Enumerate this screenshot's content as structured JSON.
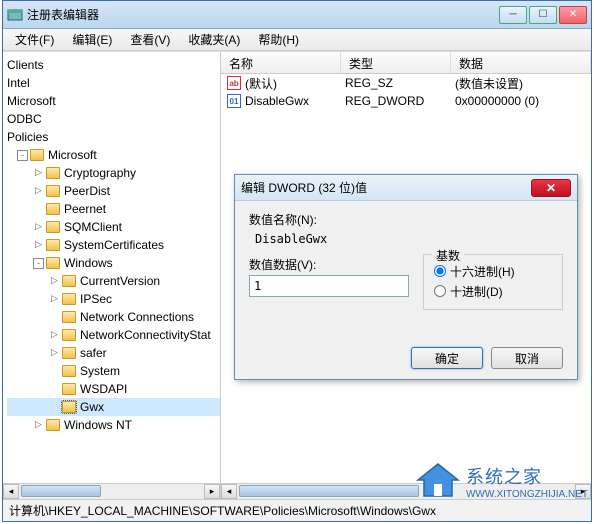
{
  "window": {
    "title": "注册表编辑器",
    "menus": [
      "文件(F)",
      "编辑(E)",
      "查看(V)",
      "收藏夹(A)",
      "帮助(H)"
    ]
  },
  "tree": {
    "roots": [
      "Clients",
      "Intel",
      "Microsoft",
      "ODBC",
      "Policies"
    ],
    "policies_microsoft": "Microsoft",
    "ms_children": [
      "Cryptography",
      "PeerDist",
      "Peernet",
      "SQMClient",
      "SystemCertificates"
    ],
    "windows_label": "Windows",
    "win_children": [
      "CurrentVersion",
      "IPSec",
      "Network Connections",
      "NetworkConnectivityStat",
      "safer",
      "System",
      "WSDAPI",
      "Gwx"
    ],
    "windows_nt": "Windows NT"
  },
  "list": {
    "headers": {
      "name": "名称",
      "type": "类型",
      "data": "数据"
    },
    "rows": [
      {
        "icon": "sz",
        "name": "(默认)",
        "type": "REG_SZ",
        "data": "(数值未设置)"
      },
      {
        "icon": "dword",
        "name": "DisableGwx",
        "type": "REG_DWORD",
        "data": "0x00000000 (0)"
      }
    ]
  },
  "dialog": {
    "title": "编辑 DWORD (32 位)值",
    "name_label": "数值名称(N):",
    "name_value": "DisableGwx",
    "data_label": "数值数据(V):",
    "data_value": "1",
    "base_label": "基数",
    "radio_hex": "十六进制(H)",
    "radio_dec": "十进制(D)",
    "ok": "确定",
    "cancel": "取消"
  },
  "statusbar": "计算机\\HKEY_LOCAL_MACHINE\\SOFTWARE\\Policies\\Microsoft\\Windows\\Gwx",
  "watermark": {
    "brand": "系统之家",
    "url": "WWW.XITONGZHIJIA.NET"
  }
}
